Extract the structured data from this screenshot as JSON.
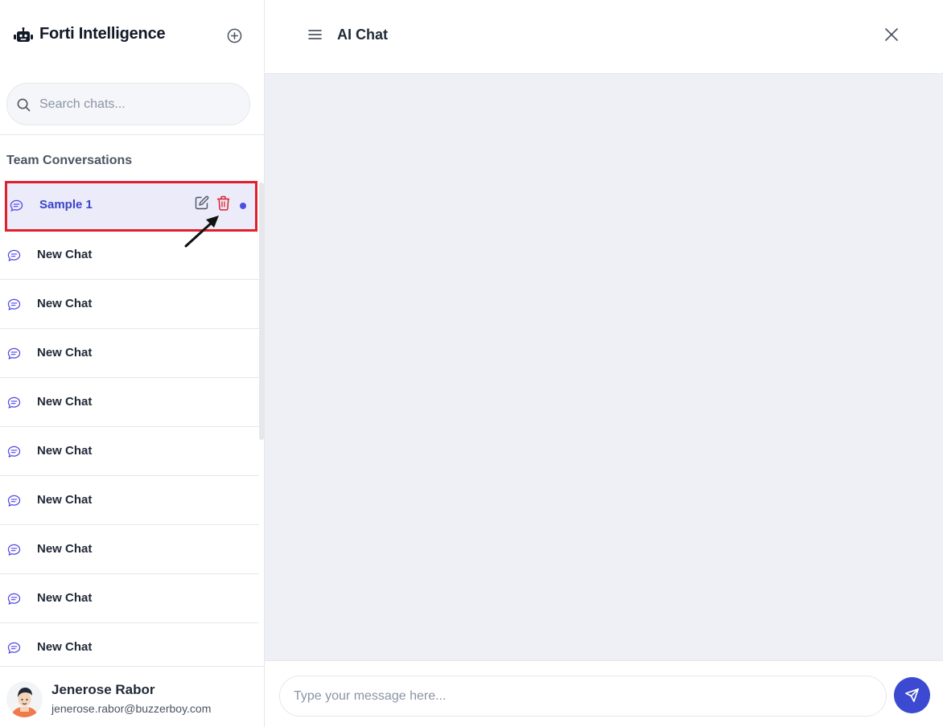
{
  "sidebar": {
    "brand": {
      "title": "Forti Intelligence",
      "icon": "robot-icon"
    },
    "new_chat_icon": "plus-circle-icon",
    "search": {
      "placeholder": "Search chats...",
      "value": "",
      "icon": "search-icon"
    },
    "section_title": "Team Conversations",
    "chats": [
      {
        "label": "Sample 1",
        "active": true,
        "actions": [
          "edit-icon",
          "trash-icon"
        ],
        "unread_dot": true
      },
      {
        "label": "New Chat"
      },
      {
        "label": "New Chat"
      },
      {
        "label": "New Chat"
      },
      {
        "label": "New Chat"
      },
      {
        "label": "New Chat"
      },
      {
        "label": "New Chat"
      },
      {
        "label": "New Chat"
      },
      {
        "label": "New Chat"
      },
      {
        "label": "New Chat"
      }
    ],
    "user": {
      "name": "Jenerose Rabor",
      "email": "jenerose.rabor@buzzerboy.com"
    }
  },
  "main": {
    "title": "AI Chat",
    "menu_icon": "hamburger-icon",
    "close_icon": "close-icon",
    "composer": {
      "placeholder": "Type your message here...",
      "value": "",
      "send_icon": "send-icon"
    }
  },
  "colors": {
    "accent": "#3b4ad0",
    "active_bg": "#ebebfa",
    "highlight_border": "#e0202c",
    "delete": "#e0202c",
    "messages_bg": "#eef0f5"
  }
}
